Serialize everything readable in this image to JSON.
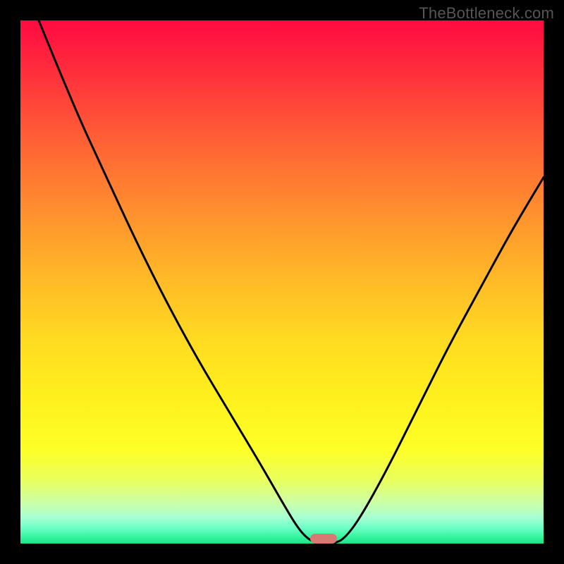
{
  "watermark": "TheBottleneck.com",
  "chart_data": {
    "type": "line",
    "title": "",
    "xlabel": "",
    "ylabel": "",
    "xlim": [
      0,
      100
    ],
    "ylim": [
      0,
      100
    ],
    "grid": false,
    "legend": false,
    "curve_points": [
      {
        "x": 3.5,
        "y": 100
      },
      {
        "x": 10,
        "y": 84
      },
      {
        "x": 16,
        "y": 71
      },
      {
        "x": 22,
        "y": 58
      },
      {
        "x": 28,
        "y": 46
      },
      {
        "x": 34,
        "y": 35
      },
      {
        "x": 40,
        "y": 25
      },
      {
        "x": 46,
        "y": 15
      },
      {
        "x": 50,
        "y": 8
      },
      {
        "x": 53,
        "y": 3
      },
      {
        "x": 55,
        "y": 0.8
      },
      {
        "x": 57,
        "y": 0
      },
      {
        "x": 60,
        "y": 0
      },
      {
        "x": 62,
        "y": 1
      },
      {
        "x": 65,
        "y": 5
      },
      {
        "x": 70,
        "y": 14
      },
      {
        "x": 76,
        "y": 26
      },
      {
        "x": 82,
        "y": 38
      },
      {
        "x": 88,
        "y": 49
      },
      {
        "x": 94,
        "y": 60
      },
      {
        "x": 100,
        "y": 70
      }
    ],
    "marker": {
      "x": 58,
      "y": 0,
      "color": "#d87a74"
    },
    "gradient_stops": [
      {
        "pos": 0,
        "color": "#ff0a41"
      },
      {
        "pos": 50,
        "color": "#ffd822"
      },
      {
        "pos": 100,
        "color": "#18e489"
      }
    ]
  }
}
